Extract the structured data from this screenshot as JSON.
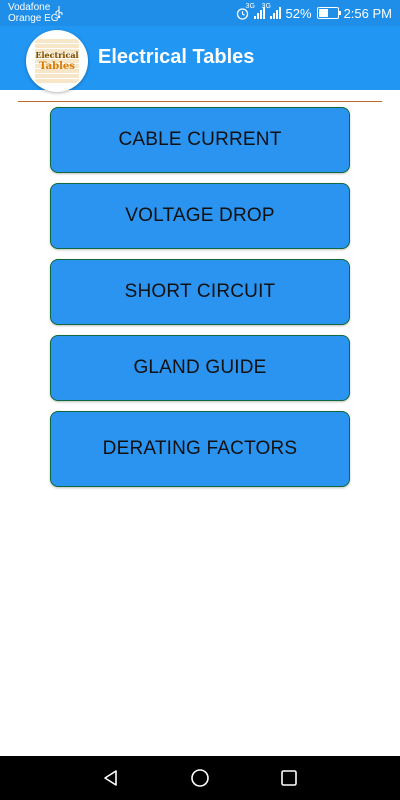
{
  "status_bar": {
    "carrier_line1": "Vodafone",
    "carrier_line2": "Orange EG",
    "network1": "3G",
    "network2": "3G",
    "battery": "52%",
    "time": "2:56 PM"
  },
  "app_bar": {
    "title": "Electrical Tables",
    "logo_line1": "Electrical",
    "logo_line2": "Tables"
  },
  "menu": {
    "items": [
      {
        "label": "CABLE CURRENT"
      },
      {
        "label": "VOLTAGE DROP"
      },
      {
        "label": "SHORT CIRCUIT"
      },
      {
        "label": "GLAND GUIDE"
      },
      {
        "label": "DERATING FACTORS"
      }
    ]
  },
  "colors": {
    "status_bar": "#1f8ee8",
    "app_bar": "#2196f3",
    "button": "#2b93f0",
    "button_border": "#0c6a3c",
    "divider": "#c0682e"
  },
  "icons": {
    "usb": "usb-icon",
    "alarm": "alarm-icon",
    "signal": "signal-icon",
    "battery": "battery-icon",
    "back": "back-icon",
    "home": "home-icon",
    "recent": "recent-apps-icon"
  }
}
